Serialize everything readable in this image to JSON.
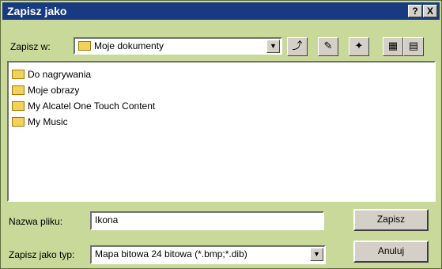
{
  "window": {
    "title": "Zapisz jako",
    "help_label": "?",
    "close_label": "X"
  },
  "save_in": {
    "label": "Zapisz w:",
    "value": "Moje dokumenty"
  },
  "files": [
    "Do nagrywania",
    "Moje obrazy",
    "My Alcatel One Touch Content",
    "My Music"
  ],
  "filename": {
    "label": "Nazwa pliku:",
    "value": "Ikona"
  },
  "filetype": {
    "label": "Zapisz jako typ:",
    "value": "Mapa bitowa 24 bitowa (*.bmp;*.dib)"
  },
  "buttons": {
    "save": "Zapisz",
    "cancel": "Anuluj"
  }
}
